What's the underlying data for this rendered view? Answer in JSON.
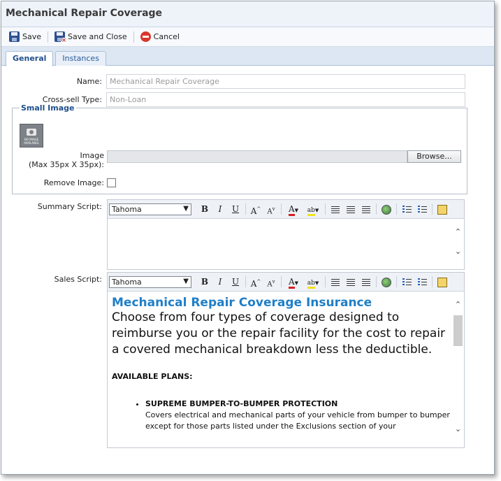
{
  "window": {
    "title": "Mechanical Repair Coverage"
  },
  "toolbar": {
    "save": "Save",
    "save_close": "Save and Close",
    "cancel": "Cancel"
  },
  "tabs": [
    {
      "label": "General",
      "active": true
    },
    {
      "label": "Instances",
      "active": false
    }
  ],
  "form": {
    "name_label": "Name:",
    "name_value": "Mechanical Repair Coverage",
    "crosssell_label": "Cross-sell Type:",
    "crosssell_value": "Non-Loan",
    "small_image": {
      "legend": "Small Image",
      "placeholder_text": "NO IMAGE AVAILABLE",
      "image_label_line1": "Image",
      "image_label_line2": "(Max 35px X 35px):",
      "browse_label": "Browse...",
      "remove_label": "Remove Image:",
      "remove_checked": false
    },
    "summary_label": "Summary Script:",
    "sales_label": "Sales Script:",
    "editor_font": "Tahoma"
  },
  "sales_script": {
    "heading": "Mechanical Repair Coverage Insurance",
    "lead": "Choose from four types of coverage designed to reimburse you or the repair facility for the cost to repair a covered mechanical breakdown less the deductible.",
    "plans_heading": "AVAILABLE PLANS:",
    "plan1_title": "SUPREME BUMPER-TO-BUMPER PROTECTION",
    "plan1_desc": "Covers electrical and mechanical parts of your vehicle from bumper to bumper except for those parts listed under the Exclusions section of your"
  },
  "colors": {
    "accent": "#1f4e8c",
    "heading_blue": "#1f7fc7",
    "toolbar_bg": "#eef3fa"
  }
}
